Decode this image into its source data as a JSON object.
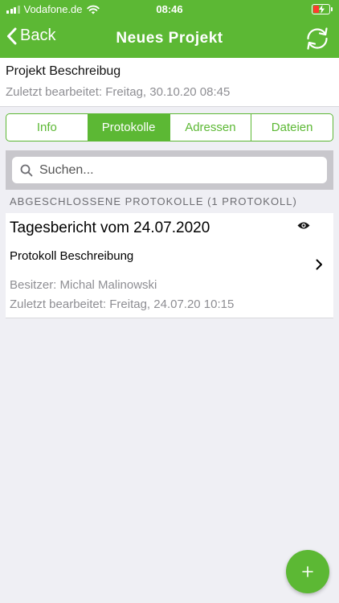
{
  "status_bar": {
    "carrier": "Vodafone.de",
    "time": "08:46",
    "battery_color": "#ff3b30"
  },
  "nav": {
    "back_label": "Back",
    "title": "Neues Projekt",
    "right_icon": "sync-icon"
  },
  "project": {
    "name": "Projekt Beschreibug",
    "last_edited": "Zuletzt bearbeitet: Freitag, 30.10.20 08:45"
  },
  "tabs": [
    {
      "label": "Info",
      "active": false
    },
    {
      "label": "Protokolle",
      "active": true
    },
    {
      "label": "Adressen",
      "active": false
    },
    {
      "label": "Dateien",
      "active": false
    }
  ],
  "search": {
    "placeholder": "Suchen...",
    "value": ""
  },
  "section": {
    "header": "ABGESCHLOSSENE PROTOKOLLE (1 PROTOKOLL)"
  },
  "protocols": [
    {
      "title": "Tagesbericht vom 24.07.2020",
      "description": "Protokoll Beschreibung",
      "owner": "Besitzer: Michal Malinowski",
      "last_edited": "Zuletzt bearbeitet: Freitag, 24.07.20 10:15"
    }
  ],
  "fab": {
    "icon": "plus-icon"
  },
  "colors": {
    "accent": "#5cb834",
    "background": "#efeff4",
    "secondary_text": "#8e8e93"
  }
}
